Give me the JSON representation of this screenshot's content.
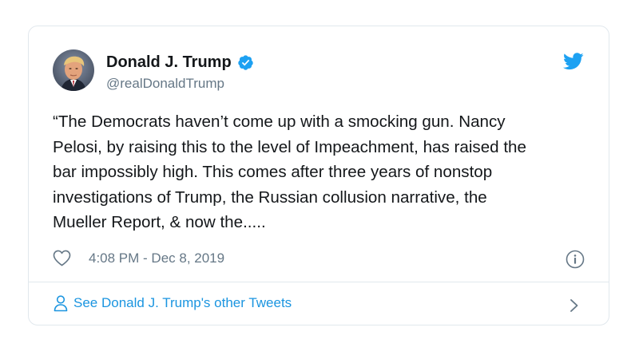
{
  "author": {
    "name": "Donald J. Trump",
    "handle": "@realDonaldTrump",
    "verified": true,
    "avatar_icon": "profile-photo"
  },
  "tweet": {
    "text": "“The Democrats haven’t come up with a smocking gun. Nancy\nPelosi, by raising this to the level of Impeachment, has raised the\nbar impossibly high. This comes after three years of nonstop\ninvestigations of Trump, the Russian collusion narrative, the\nMueller Report, & now the.....",
    "timestamp": "4:08 PM - Dec 8, 2019"
  },
  "footer": {
    "link_label": "See Donald J. Trump's other Tweets"
  },
  "icons": {
    "brand": "twitter-bird-icon",
    "verified": "verified-badge-icon",
    "like": "heart-icon",
    "info": "info-icon",
    "person": "person-icon",
    "chevron": "chevron-right-icon"
  },
  "colors": {
    "brand_blue": "#1da1f2",
    "link_blue": "#1b95e0",
    "text": "#14171a",
    "secondary": "#657786",
    "border": "#e1e8ed"
  }
}
